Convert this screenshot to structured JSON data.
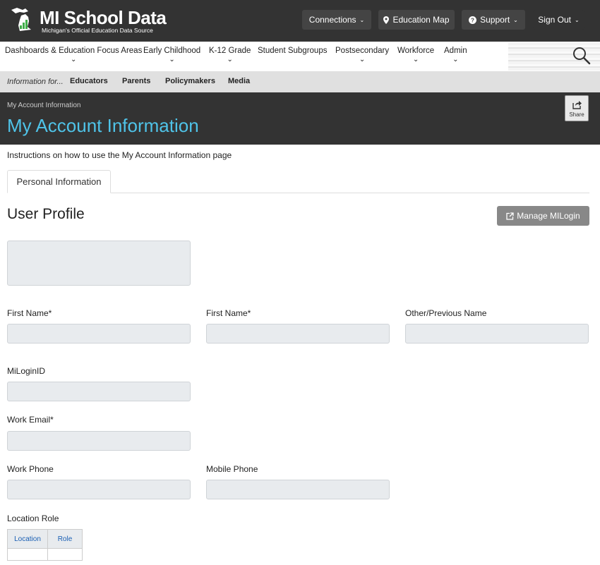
{
  "header": {
    "logo_title": "MI School Data",
    "logo_subtitle": "Michigan's Official Education Data Source",
    "nav": {
      "connections": "Connections",
      "education_map": "Education Map",
      "support": "Support",
      "sign_out": "Sign Out"
    }
  },
  "main_nav": {
    "items": [
      {
        "label": "Dashboards & Education Focus Areas",
        "has_dropdown": true
      },
      {
        "label": "Early Childhood",
        "has_dropdown": true
      },
      {
        "label": "K-12 Grade",
        "has_dropdown": true
      },
      {
        "label": "Student Subgroups",
        "has_dropdown": false
      },
      {
        "label": "Postsecondary",
        "has_dropdown": true
      },
      {
        "label": "Workforce",
        "has_dropdown": true
      },
      {
        "label": "Admin",
        "has_dropdown": true
      }
    ]
  },
  "info_bar": {
    "label": "Information for...",
    "links": [
      "Educators",
      "Parents",
      "Policymakers",
      "Media"
    ]
  },
  "page_header": {
    "breadcrumb": "My Account Information",
    "title": "My Account Information",
    "share_label": "Share"
  },
  "content": {
    "instructions": "Instructions on how to use the My Account Information page",
    "tab_label": "Personal Information",
    "section_title": "User Profile",
    "manage_button": "Manage MILogin"
  },
  "form": {
    "first_name_label": "First Name*",
    "first_name_2_label": "First Name*",
    "other_name_label": "Other/Previous Name",
    "milogin_label": "MiLoginID",
    "work_email_label": "Work Email*",
    "work_phone_label": "Work Phone",
    "mobile_phone_label": "Mobile Phone",
    "location_role_label": "Location Role",
    "table_headers": [
      "Location",
      "Role"
    ]
  },
  "colors": {
    "topbar": "#333333",
    "accent_title": "#4fc3e8",
    "link_blue": "#1a5fb4",
    "input_bg": "#e8ebee"
  }
}
